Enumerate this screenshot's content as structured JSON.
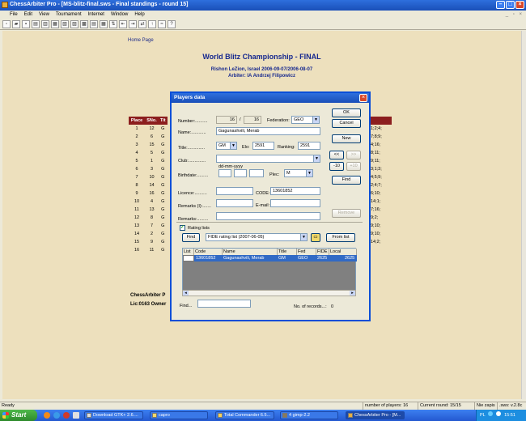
{
  "window": {
    "title": "ChessArbiter Pro - [MS-blitz-final.sws - Final standings - round 15]"
  },
  "menu": [
    "File",
    "Edit",
    "View",
    "Tournament",
    "Internet",
    "Window",
    "Help"
  ],
  "mdi_controls": "_ ▫ ×",
  "page": {
    "home_link": "Home Page",
    "title": "World Blitz Championship - FINAL",
    "venue": "Rishon LeZion, Israel 2006-09-07/2006-08-07",
    "arbiter": "Arbiter: IA Andrzej Filipowicz"
  },
  "standings": {
    "headers": [
      "Place",
      "SNo.",
      "Tit"
    ],
    "rows": [
      [
        "1",
        "12",
        "G"
      ],
      [
        "2",
        "6",
        "G"
      ],
      [
        "3",
        "15",
        "G"
      ],
      [
        "4",
        "5",
        "G"
      ],
      [
        "5",
        "1",
        "G"
      ],
      [
        "6",
        "3",
        "G"
      ],
      [
        "7",
        "10",
        "G"
      ],
      [
        "8",
        "14",
        "G"
      ],
      [
        "9",
        "16",
        "G"
      ],
      [
        "10",
        "4",
        "G"
      ],
      [
        "11",
        "13",
        "G"
      ],
      [
        "12",
        "8",
        "G"
      ],
      [
        "13",
        "7",
        "G"
      ],
      [
        "14",
        "2",
        "G"
      ],
      [
        "15",
        "9",
        "G"
      ],
      [
        "16",
        "11",
        "G"
      ]
    ],
    "right_col": [
      "1;2;4;",
      "7;8;9;",
      "4;16;",
      "8;11;",
      "9;11;",
      "3;1;3;",
      "4;5;9;",
      "2;4;7;",
      "6;10;",
      "14;1;",
      "7;16;",
      "9;2;",
      "9;10;",
      "9;10;",
      "14;2;",
      ""
    ]
  },
  "footer": {
    "line1": "ChessArbiter P",
    "line2": "Lic:0163 Owner"
  },
  "dialog": {
    "title": "Players data",
    "number_label": "Number:..........",
    "number_value": "16",
    "number_sep": "/",
    "number_total": "16",
    "federation_label": "Federation:",
    "federation_value": "GEO",
    "name_label": "Name:............",
    "name_value": "Gagunashvili, Merab",
    "title_label": "Title:..............",
    "title_value": "GM",
    "elo_label": "Elo:",
    "elo_value": "2591",
    "ranking_label": "Ranking:",
    "ranking_value": "2591",
    "club_label": "Club:..............",
    "club_value": "",
    "date_hint": "dd-mm-yyyy",
    "birthdate_label": "Birthdate:.........",
    "plec_label": "Plec:",
    "plec_value": "M",
    "licence_label": "Licence:..........",
    "code_label": "CODE:",
    "code_value": "13601852",
    "remarks_b_label": "Remarks (I):.......",
    "email_label": "E-mail:",
    "remarks_label": "Remarks:.........",
    "buttons": {
      "ok": "OK",
      "cancel": "Cancel",
      "new": "New",
      "prev": "<<",
      "next": ">>",
      "minus10": "-10",
      "plus10": "+10",
      "find": "Find",
      "remove": "Remove",
      "find_list": "Find",
      "from_list": "From list"
    },
    "rating_lists_label": "Rating lists",
    "rating_list_value": "FIDE rating list (2007-06-05)",
    "grid": {
      "headers": [
        "List",
        "Code",
        "Name",
        "Title",
        "Fed",
        "FIDE",
        "Local"
      ],
      "row": [
        "",
        "13601852",
        "Gagunashvili, Merab",
        "GM",
        "GEO",
        "2625",
        "2625"
      ]
    },
    "find_label": "Find...",
    "records_label": "No. of records...:",
    "records_value": "0"
  },
  "status": {
    "left": "Ready",
    "players": "number of players: 16",
    "round": "Current round: 15/15",
    "saved": "Nie zapis",
    "version": ".sws: v.2.8c"
  },
  "taskbar": {
    "start": "Start",
    "tasks": [
      "Download GTK+ 2.6....",
      "capro",
      "Total Commander 6.5...",
      "4 gimp-2.2",
      "ChessArbiter Pro - [M..."
    ],
    "lang": "PL",
    "time": "15:51"
  }
}
